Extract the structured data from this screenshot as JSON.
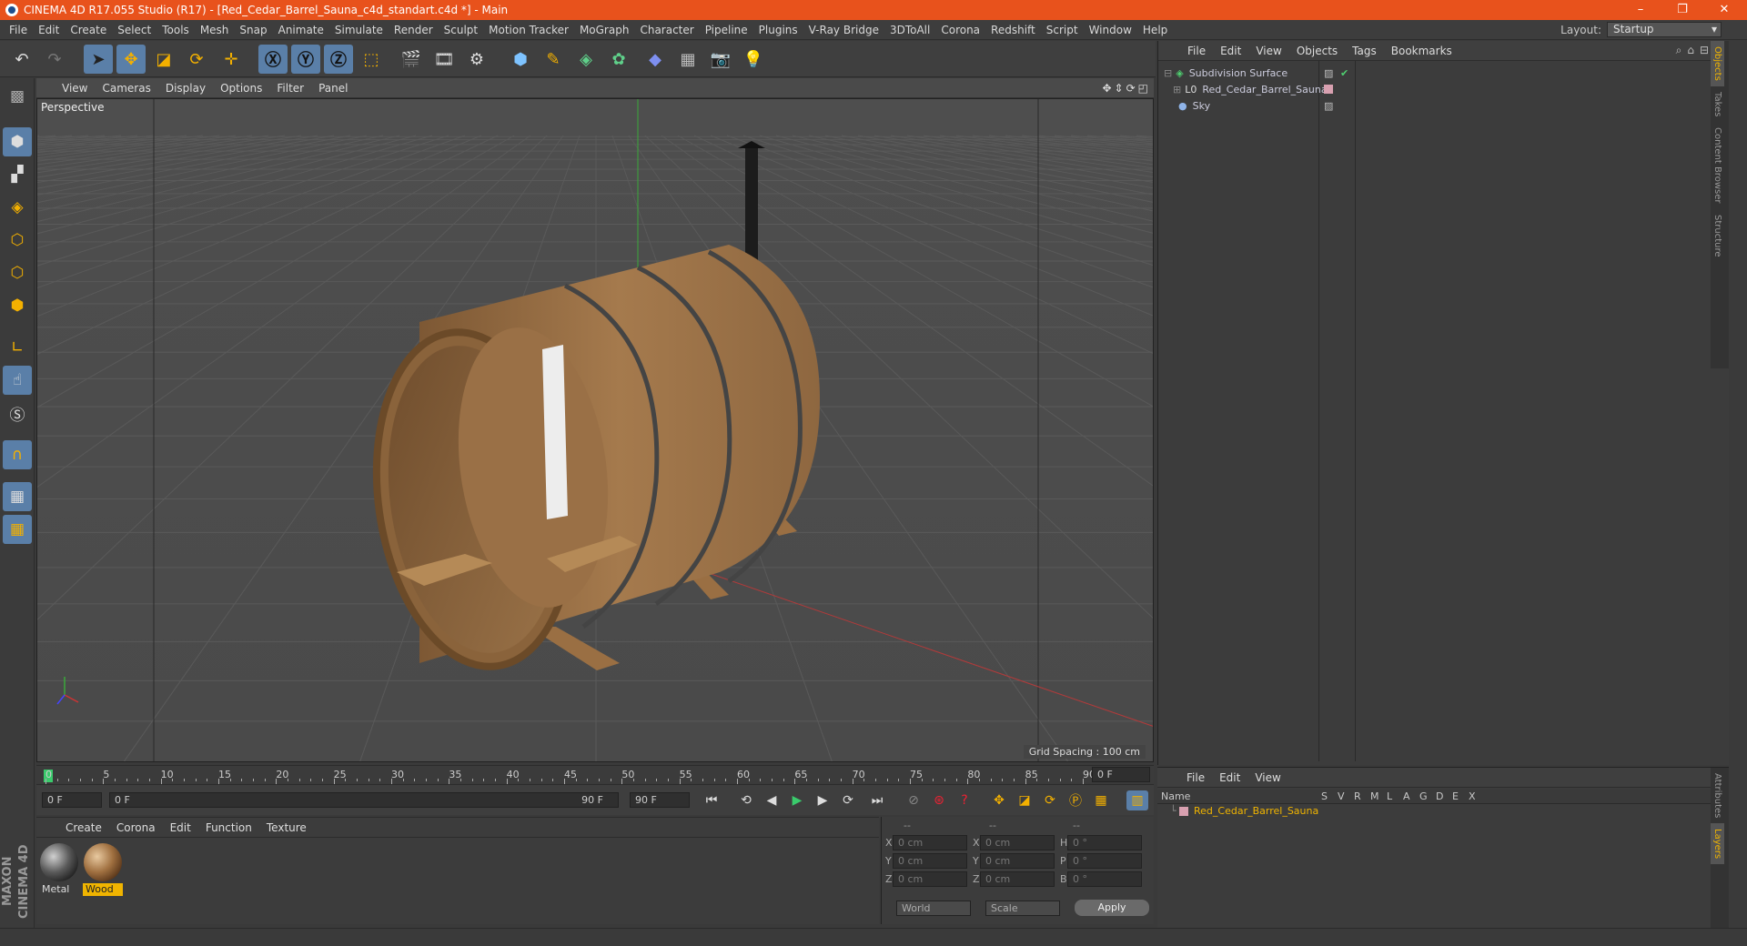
{
  "window": {
    "title": "CINEMA 4D R17.055 Studio (R17) - [Red_Cedar_Barrel_Sauna_c4d_standart.c4d *] - Main"
  },
  "menubar": {
    "items": [
      "File",
      "Edit",
      "Create",
      "Select",
      "Tools",
      "Mesh",
      "Snap",
      "Animate",
      "Simulate",
      "Render",
      "Sculpt",
      "Motion Tracker",
      "MoGraph",
      "Character",
      "Pipeline",
      "Plugins",
      "V-Ray Bridge",
      "3DToAll",
      "Corona",
      "Redshift",
      "Script",
      "Window",
      "Help"
    ]
  },
  "layout": {
    "label": "Layout:",
    "value": "Startup"
  },
  "viewport": {
    "menu": [
      "View",
      "Cameras",
      "Display",
      "Options",
      "Filter",
      "Panel"
    ],
    "label": "Perspective",
    "grid_spacing": "Grid Spacing : 100 cm"
  },
  "object_manager": {
    "menu": [
      "File",
      "Edit",
      "View",
      "Objects",
      "Tags",
      "Bookmarks"
    ],
    "objects": [
      {
        "name": "Subdivision Surface"
      },
      {
        "name": "Red_Cedar_Barrel_Sauna"
      },
      {
        "name": "Sky"
      }
    ]
  },
  "side_tabs": [
    "Objects",
    "Takes",
    "Content Browser",
    "Structure"
  ],
  "side_tabs_bottom": [
    "Attributes",
    "Layers"
  ],
  "timeline": {
    "ticks": [
      "0",
      "5",
      "10",
      "15",
      "20",
      "25",
      "30",
      "35",
      "40",
      "45",
      "50",
      "55",
      "60",
      "65",
      "70",
      "75",
      "80",
      "85",
      "90"
    ],
    "frame_field": "0 F"
  },
  "transport": {
    "start_field": "0 F",
    "range_start": "0 F",
    "range_end": "90 F",
    "end_field": "90 F"
  },
  "material_manager": {
    "menu": [
      "Create",
      "Corona",
      "Edit",
      "Function",
      "Texture"
    ],
    "materials": [
      {
        "name": "Metal"
      },
      {
        "name": "Wood"
      }
    ]
  },
  "coordinates": {
    "headers": [
      "--",
      "--",
      "--"
    ],
    "rows": [
      {
        "a": "X",
        "av": "0 cm",
        "b": "X",
        "bv": "0 cm",
        "c": "H",
        "cv": "0 °"
      },
      {
        "a": "Y",
        "av": "0 cm",
        "b": "Y",
        "bv": "0 cm",
        "c": "P",
        "cv": "0 °"
      },
      {
        "a": "Z",
        "av": "0 cm",
        "b": "Z",
        "bv": "0 cm",
        "c": "B",
        "cv": "0 °"
      }
    ],
    "mode": "World",
    "size_mode": "Scale",
    "apply": "Apply"
  },
  "layer_manager": {
    "menu": [
      "File",
      "Edit",
      "View"
    ],
    "header_name": "Name",
    "columns": [
      "S",
      "V",
      "R",
      "M",
      "L",
      "A",
      "G",
      "D",
      "E",
      "X"
    ],
    "layer": "Red_Cedar_Barrel_Sauna"
  },
  "brand": "MAXON CINEMA 4D",
  "colors": {
    "title_bg": "#e8521c",
    "active_blue": "#5a7fa8",
    "highlight": "#f0b400"
  }
}
